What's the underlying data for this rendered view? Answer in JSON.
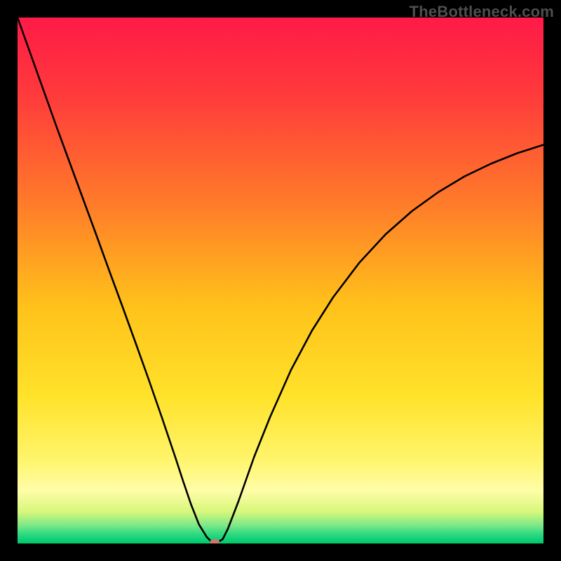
{
  "watermark": "TheBottleneck.com",
  "chart_data": {
    "type": "line",
    "title": "",
    "xlabel": "",
    "ylabel": "",
    "xlim": [
      0,
      100
    ],
    "ylim": [
      0,
      100
    ],
    "gradient_stops": [
      {
        "offset": 0.0,
        "color": "#ff1a48"
      },
      {
        "offset": 0.15,
        "color": "#ff3b3b"
      },
      {
        "offset": 0.35,
        "color": "#ff7a2a"
      },
      {
        "offset": 0.55,
        "color": "#ffc21a"
      },
      {
        "offset": 0.72,
        "color": "#ffe22a"
      },
      {
        "offset": 0.84,
        "color": "#fff56b"
      },
      {
        "offset": 0.9,
        "color": "#fffda8"
      },
      {
        "offset": 0.94,
        "color": "#d7f77a"
      },
      {
        "offset": 0.965,
        "color": "#7ee889"
      },
      {
        "offset": 0.985,
        "color": "#23d77f"
      },
      {
        "offset": 1.0,
        "color": "#00c86a"
      }
    ],
    "series": [
      {
        "name": "bottleneck-curve",
        "x": [
          0.0,
          2.5,
          5.0,
          7.5,
          10.0,
          12.5,
          15.0,
          17.5,
          20.0,
          22.5,
          25.0,
          27.5,
          30.0,
          31.5,
          33.0,
          34.5,
          36.0,
          36.7,
          37.3,
          38.0,
          39.0,
          40.0,
          42.0,
          45.0,
          48.0,
          52.0,
          56.0,
          60.0,
          65.0,
          70.0,
          75.0,
          80.0,
          85.0,
          90.0,
          95.0,
          100.0
        ],
        "y": [
          100.0,
          93.0,
          86.0,
          79.0,
          72.2,
          65.4,
          58.6,
          51.7,
          44.9,
          38.0,
          31.0,
          23.8,
          16.4,
          11.8,
          7.4,
          3.6,
          1.2,
          0.5,
          0.3,
          0.2,
          0.8,
          2.8,
          8.0,
          16.5,
          24.0,
          33.0,
          40.5,
          46.8,
          53.4,
          58.8,
          63.2,
          66.8,
          69.8,
          72.2,
          74.2,
          75.8
        ]
      }
    ],
    "marker": {
      "x": 37.5,
      "y": 0.2,
      "color": "#c6796b"
    }
  }
}
